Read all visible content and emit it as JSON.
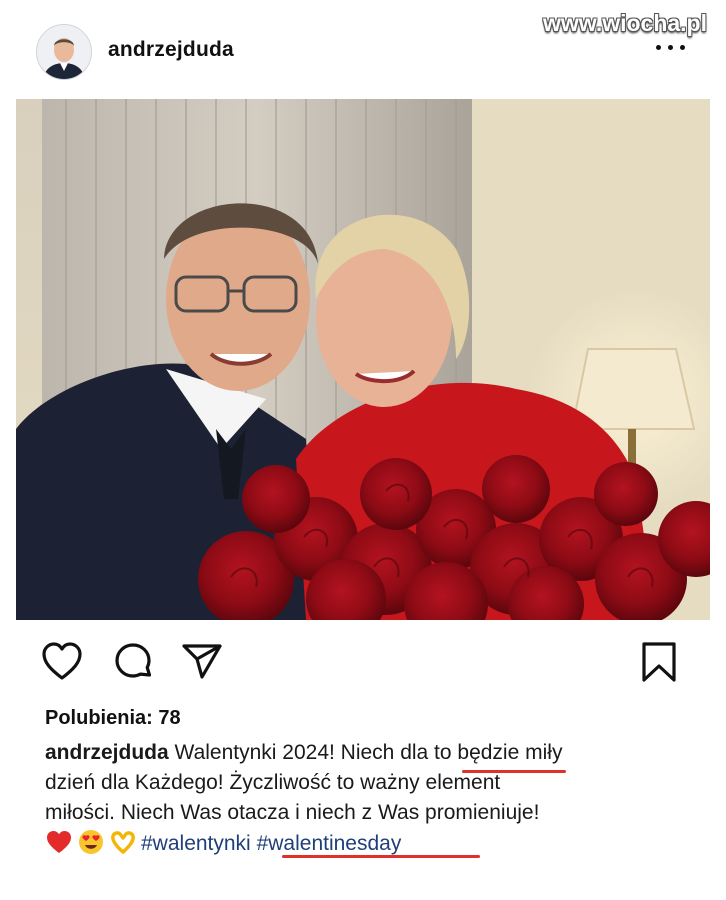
{
  "watermark": "www.wiocha.pl",
  "post": {
    "username": "andrzejduda",
    "photo_alt": "",
    "likes_label": "Polubienia: 78",
    "caption_user": "andrzejduda",
    "caption_line1": " Walentynki 2024! Niech dla to będzie miły",
    "caption_line2": "dzień dla Każdego! Życzliwość to ważny element",
    "caption_line3": "miłości. Niech Was otacza i niech z Was promieniuje!",
    "hashtags": [
      "#walentynki",
      "#walentinesday"
    ],
    "emojis": [
      "red-heart",
      "heart-eyes",
      "heart-hands"
    ]
  },
  "icons": {
    "like": "heart-icon",
    "comment": "comment-icon",
    "share": "send-icon",
    "save": "bookmark-icon",
    "more": "more-icon"
  },
  "colors": {
    "hashtag": "#1f3f7a",
    "annotation": "#e0302a",
    "text": "#111111"
  }
}
